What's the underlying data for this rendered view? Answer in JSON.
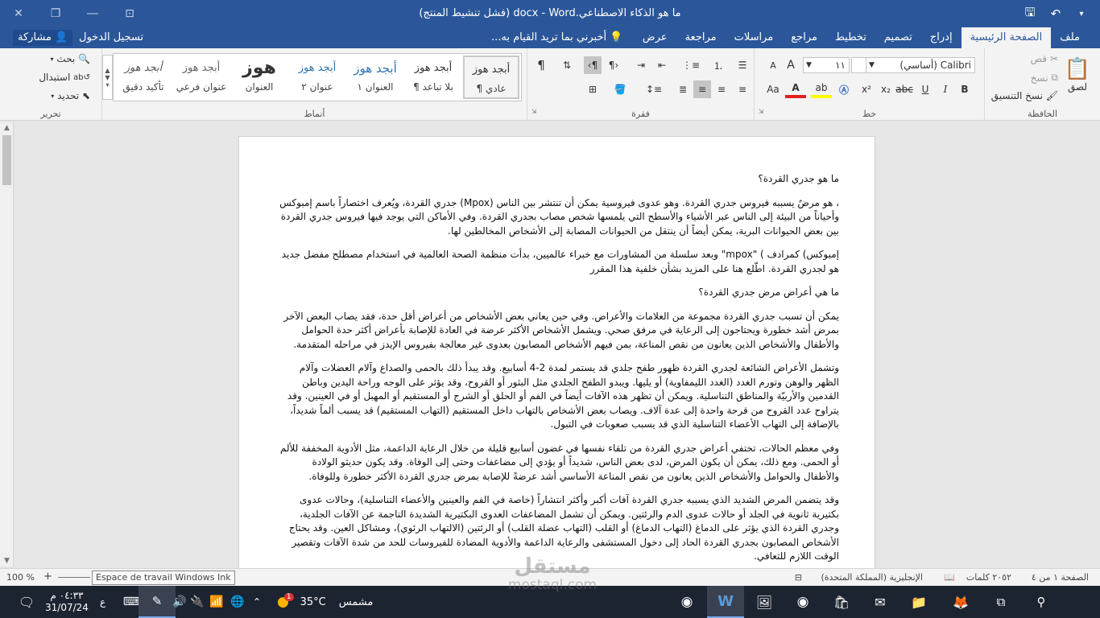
{
  "titlebar": {
    "title": "ما هو الذكاء الاصطناعي.docx - Word (فشل تنشيط المنتج)",
    "save_icon": "save-icon",
    "undo_icon": "undo-icon",
    "customize_icon": "dropdown-icon"
  },
  "tabs": {
    "items": [
      "ملف",
      "الصفحة الرئيسية",
      "إدراج",
      "تصميم",
      "تخطيط",
      "مراجع",
      "مراسلات",
      "مراجعة",
      "عرض"
    ],
    "active": "الصفحة الرئيسية",
    "tell_me": "أخبرني بما تريد القيام به...",
    "sign_in": "تسجيل الدخول",
    "share": "مشاركة"
  },
  "ribbon": {
    "clipboard": {
      "label": "الحافظة",
      "paste": "لصق",
      "cut": "قص",
      "copy": "نسخ",
      "format_painter": "نسخ التنسيق"
    },
    "font": {
      "label": "خط",
      "font_name": "Calibri (أساسي)",
      "font_size": "١١",
      "bold": "B",
      "italic": "I",
      "underline": "U",
      "sub": "x₂",
      "sup": "x²",
      "grow": "A",
      "shrink": "A",
      "case": "Aa"
    },
    "paragraph": {
      "label": "فقرة"
    },
    "styles": {
      "label": "أنماط",
      "items": [
        {
          "sample": "أبجد هوز",
          "name": "¶ عادي"
        },
        {
          "sample": "أبجد هوز",
          "name": "¶ بلا تباعد"
        },
        {
          "sample": "أبجد هوز",
          "name": "العنوان ١"
        },
        {
          "sample": "أبجد هوز",
          "name": "عنوان ٢"
        },
        {
          "sample": "هوز",
          "name": "العنوان"
        },
        {
          "sample": "أبجد هوز",
          "name": "عنوان فرعي"
        },
        {
          "sample": "أبجد هوز",
          "name": "تأكيد دقيق"
        }
      ]
    },
    "editing": {
      "label": "تحرير",
      "find": "بحث",
      "replace": "استبدال",
      "select": "تحديد"
    }
  },
  "document": {
    "paragraphs": [
      "ما هو جدري القردة؟",
      "، هو مرضٌ يسببه فيروس جدري القردة. وهو عدوى فيروسية يمكن أن تنتشر بين الناس (Mpox) جدري القردة، ويُعرف اختصاراً باسم إمبوكس وأحياناً من البيئة إلى الناس عبر الأشياء والأسطح التي يلمسها شخص مصاب بجدري القردة. وفي الأماكن التي يوجد فيها فيروس جدري القردة بين بعض الحيوانات البرية، يمكن أيضاً أن ينتقل من الحيوانات المصابة إلى الأشخاص المخالطين لها.",
      "إمبوكس) كمرادف ) \"mpox\" وبعد سلسلة من المشاورات مع خبراء عالميين، بدأت منظمة الصحة العالمية في استخدام مصطلح مفضل جديد هو لجدري القردة. اطّلع هنا على المزيد بشأن خلفية هذا المقرر",
      "ما هي أعراض مرض جدري القردة؟",
      "يمكن أن تسبب جدري القردة مجموعة من العلامات والأعراض. وفي حين يعاني بعض الأشخاص من أعراض أقل حدة، فقد يصاب البعض الآخر بمرض أشد خطورة ويحتاجون إلى الرعاية في مرفق صحي. ويشمل الأشخاص الأكثر عرضة في العادة للإصابة بأعراض أكثر حدة الحوامل والأطفال والأشخاص الذين يعانون من نقص المناعة، بمن فيهم الأشخاص المصابون بعدوى غير معالجة بفيروس الإيدز في مراحله المتقدمة.",
      "وتشمل الأعراض الشائعة لجدري القردة ظهور طفح جلدي قد يستمر لمدة 2-4 أسابيع. وقد يبدأ ذلك بالحمى والصداع وآلام العضلات وآلام الظهر والوهن وتورم الغدد (الغدد الليمفاوية) أو يليها. ويبدو الطفح الجلدي مثل البثور أو القروح، وقد يؤثر على الوجه وراحة اليدين وباطن القدمين والأربيّة والمناطق التناسلية. ويمكن أن تظهر هذه الآفات أيضاً في الفم أو الحلق أو الشرج أو المستقيم أو المهبل أو في العينين. وقد يتراوح عدد القروح من قرحة واحدة إلى عدة آلاف. ويصاب بعض الأشخاص بالتهاب داخل المستقيم (التهاب المستقيم) قد يسبب ألماً شديداً، بالإضافة إلى التهاب الأعضاء التناسلية الذي قد يسبب صعوبات في التبول.",
      "وفي معظم الحالات، تختفي أعراض جدري القردة من تلقاء نفسها في غضون أسابيع قليلة من خلال الرعاية الداعمة، مثل الأدوية المخففة للألم أو الحمى. ومع ذلك، يمكن أن يكون المرض، لدى بعض الناس، شديداً أو يؤدي إلى مضاعفات وحتى إلى الوفاة. وقد يكون حديثو الولادة والأطفال والحوامل والأشخاص الذين يعانون من نقص المناعة الأساسي أشد عرضةً للإصابة بمرض جدري القردة الأكثر خطورة وللوفاة.",
      "وقد يتضمن المرض الشديد الذي يسببه جدري القردة آفات أكبر وأكثر انتشاراً (خاصة في الفم والعينين والأعضاء التناسلية)، وحالات عدوى بكتيرية ثانوية في الجلد أو حالات عدوى الدم والرئتين. ويمكن أن تشمل المضاعفات العدوى البكتيرية الشديدة الناجمة عن الآفات الجلدية، وجدري القردة الذي يؤثر على الدماغ (التهاب الدماغ) أو القلب (التهاب عضلة القلب) أو الرئتين (الالتهاب الرئوي)، ومشاكل العين. وقد يحتاج الأشخاص المصابون بجدري القردة الحاد إلى دخول المستشفى والرعاية الداعمة والأدوية المضادة للفيروسات للحد من شدة الآفات وتقصير الوقت اللازم للتعافي."
    ]
  },
  "statusbar": {
    "page": "الصفحة ١ من ٤",
    "words": "٢٠٥٢ كلمات",
    "language": "الإنجليزية (المملكة المتحدة)",
    "zoom": "100 %"
  },
  "tooltip": "Espace de travail Windows Ink",
  "taskbar": {
    "weather_label": "مشمس",
    "temperature": "35°C",
    "time": "٠٤:٣٣ م",
    "date": "31/07/24",
    "lang_indicator": "ع",
    "notification_count": "1"
  },
  "watermark": {
    "line1": "مستقل",
    "line2": "mostaql.com"
  },
  "colors": {
    "word_blue": "#2b579a",
    "taskbar": "#1d2431"
  }
}
